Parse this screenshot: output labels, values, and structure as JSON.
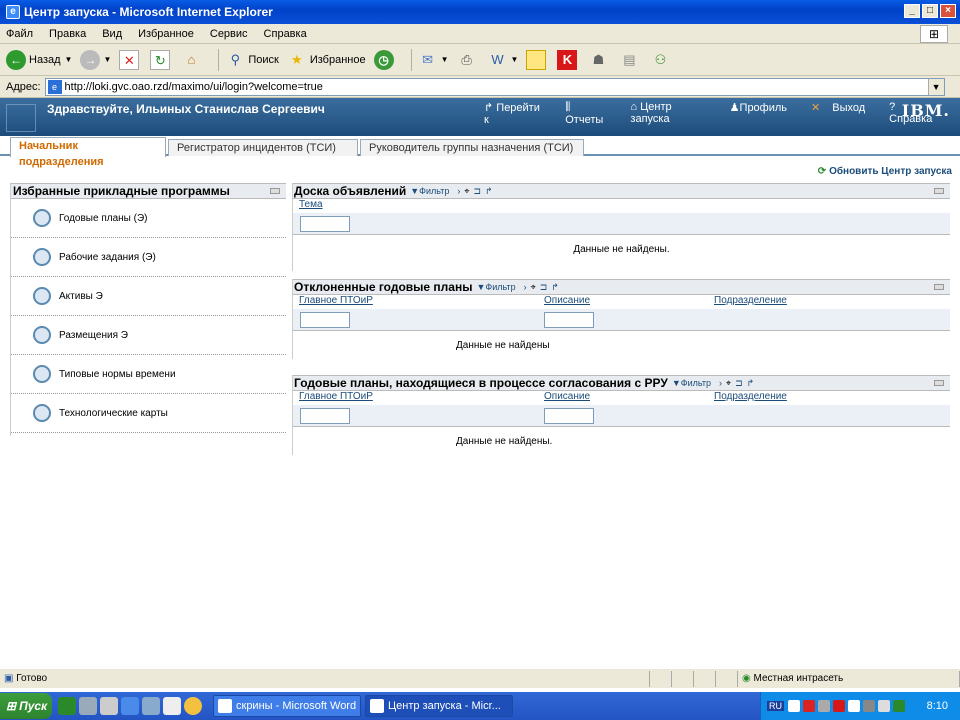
{
  "window": {
    "title": "Центр запуска - Microsoft Internet Explorer"
  },
  "menu": [
    "Файл",
    "Правка",
    "Вид",
    "Избранное",
    "Сервис",
    "Справка"
  ],
  "toolbar": {
    "back": "Назад",
    "search": "Поиск",
    "favorites": "Избранное"
  },
  "address": {
    "label": "Адрес:",
    "url": "http://loki.gvc.oao.rzd/maximo/ui/login?welcome=true"
  },
  "header": {
    "welcome": "Здравствуйте, Ильиных Станислав Сергеевич",
    "nav": [
      "Перейти к",
      "Отчеты",
      "Центр запуска",
      "Профиль",
      "Выход",
      "Справка"
    ],
    "brand": "IBM."
  },
  "tabs": [
    "Начальник подразделения",
    "Регистратор инцидентов (ТСИ)",
    "Руководитель группы назначения (ТСИ)"
  ],
  "refresh": "Обновить Центр запуска",
  "favorites": {
    "title": "Избранные прикладные программы",
    "items": [
      "Годовые планы (Э)",
      "Рабочие задания (Э)",
      "Активы Э",
      "Размещения Э",
      "Типовые нормы времени",
      "Технологические карты"
    ]
  },
  "portlet_tools": {
    "filter": "Фильтр"
  },
  "portlets": [
    {
      "title": "Доска объявлений",
      "columns": [
        "Тема"
      ],
      "nodata": "Данные не найдены."
    },
    {
      "title": "Отклоненные годовые планы",
      "columns": [
        "Главное ПТОиР",
        "Описание",
        "Подразделение"
      ],
      "nodata": "Данные не найдены"
    },
    {
      "title": "Годовые планы, находящиеся в процессе согласования с РРУ",
      "columns": [
        "Главное ПТОиР",
        "Описание",
        "Подразделение"
      ],
      "nodata": "Данные не найдены."
    }
  ],
  "status": {
    "left": "Готово",
    "zone": "Местная интрасеть"
  },
  "taskbar": {
    "start": "Пуск",
    "tasks": [
      "скрины - Microsoft Word",
      "Центр запуска - Micr..."
    ],
    "lang": "RU",
    "time": "8:10"
  }
}
